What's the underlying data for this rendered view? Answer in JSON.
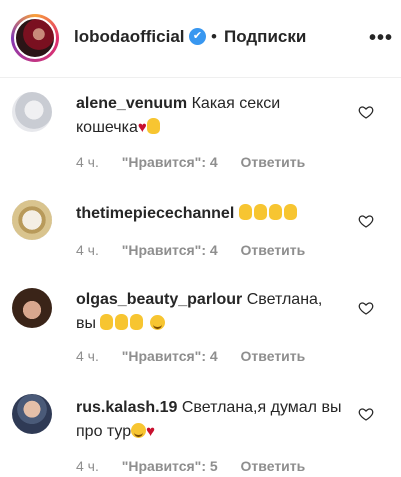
{
  "header": {
    "username": "lobodaofficial",
    "verified_icon": "✔",
    "separator": "•",
    "follow_label": "Подписки",
    "more_icon": "•••"
  },
  "comments": [
    {
      "username": "alene_venuum",
      "text": "Какая секси кошечка",
      "emojis": [
        "red-heart",
        "raised-hand"
      ],
      "time": "4 ч.",
      "likes": "\"Нравится\": 4",
      "reply": "Ответить"
    },
    {
      "username": "thetimepiecechannel",
      "text": "",
      "emojis": [
        "raised-hand",
        "raised-hand",
        "raised-hand",
        "raised-hand"
      ],
      "time": "4 ч.",
      "likes": "\"Нравится\": 4",
      "reply": "Ответить"
    },
    {
      "username": "olgas_beauty_parlour",
      "text": "Светлана, вы",
      "emojis": [
        "raised-hand",
        "raised-hand",
        "raised-hand",
        "smiling-face"
      ],
      "time": "4 ч.",
      "likes": "\"Нравится\": 4",
      "reply": "Ответить"
    },
    {
      "username": "rus.kalash.19",
      "text": "Светлана,я думал вы про тур",
      "emojis": [
        "grinning-sweat-face",
        "red-heart"
      ],
      "time": "4 ч.",
      "likes": "\"Нравится\": 5",
      "reply": "Ответить"
    }
  ]
}
